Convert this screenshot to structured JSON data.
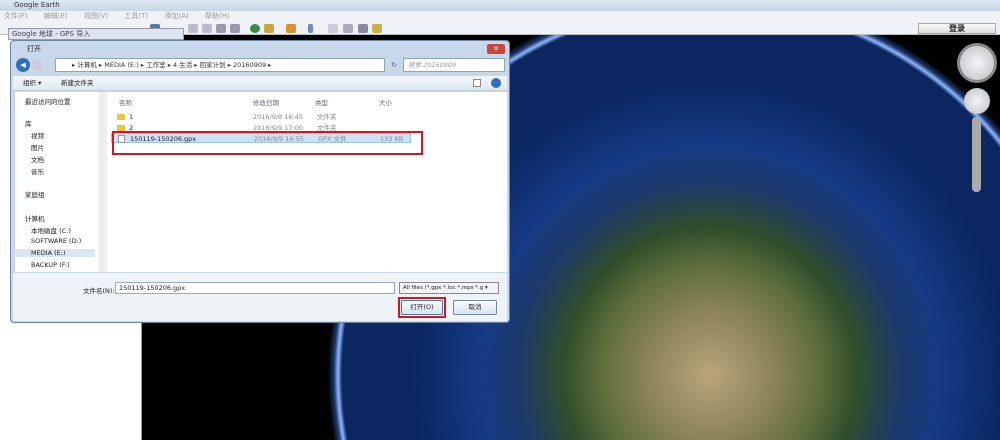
{
  "app": {
    "title": "Google Earth",
    "menu": [
      "文件(F)",
      "编辑(E)",
      "视图(V)",
      "工具(T)",
      "添加(A)",
      "帮助(H)"
    ],
    "login": "登录"
  },
  "gps_dialog": {
    "title": "Google 地球 - GPS 导入"
  },
  "open_dialog": {
    "title": "打开",
    "breadcrumb": "▸ 计算机 ▸ MEDIA (E:) ▸ 工作室 ▸ 4.生活 ▸ 回家计划 ▸ 20160909 ▸",
    "search_placeholder": "搜索 20160909",
    "organize": "组织 ▾",
    "new_folder": "新建文件夹",
    "nav": [
      {
        "label": "最近访问的位置"
      },
      {
        "label": "库"
      },
      {
        "label": "视频"
      },
      {
        "label": "图片"
      },
      {
        "label": "文档"
      },
      {
        "label": "音乐"
      },
      {
        "label": "家庭组"
      },
      {
        "label": "计算机"
      },
      {
        "label": "本地磁盘 (C:)"
      },
      {
        "label": "SOFTWARE (D:)"
      },
      {
        "label": "MEDIA (E:)"
      },
      {
        "label": "BACKUP (F:)"
      }
    ],
    "columns": [
      "名称",
      "修改日期",
      "类型",
      "大小"
    ],
    "files": [
      {
        "name": "1",
        "date": "2016/9/9 16:45",
        "type": "文件夹",
        "size": ""
      },
      {
        "name": "2",
        "date": "2016/9/9 17:00",
        "type": "文件夹",
        "size": ""
      },
      {
        "name": "150119-150206.gpx",
        "date": "2016/9/9 16:55",
        "type": "GPX 文件",
        "size": "133 KB"
      }
    ],
    "filename_label": "文件名(N):",
    "filename_value": "150119-150206.gpx",
    "filter": "All files (*.gpx *.loc *.mps *.g ▾",
    "open_button": "打开(O)",
    "cancel_button": "取消"
  },
  "colors": {
    "highlight": "#d8141c",
    "selected_row": "#cde2f7"
  }
}
